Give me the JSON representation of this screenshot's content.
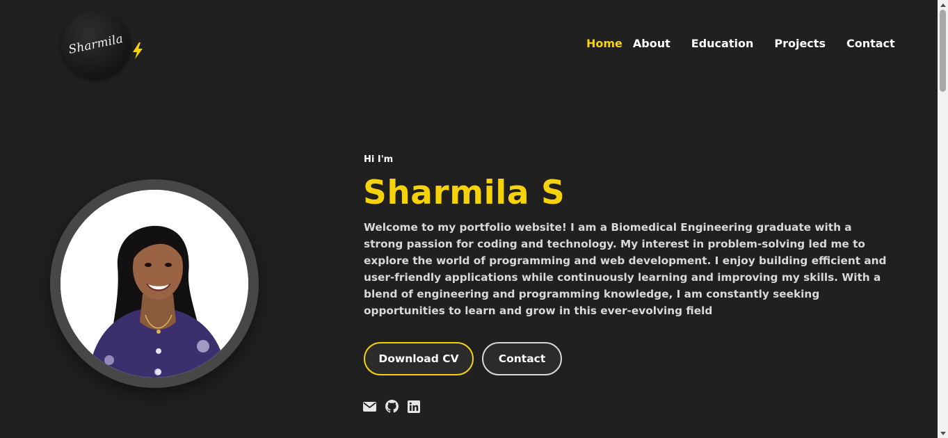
{
  "header": {
    "logo_text": "Sharmila",
    "logo_accent_icon": "lightning-bolt-icon"
  },
  "nav": {
    "items": [
      {
        "label": "Home",
        "active": true
      },
      {
        "label": "About",
        "active": false
      },
      {
        "label": "Education",
        "active": false
      },
      {
        "label": "Projects",
        "active": false
      },
      {
        "label": "Contact",
        "active": false
      }
    ]
  },
  "hero": {
    "greeting": "Hi I'm",
    "name": "Sharmila S",
    "bio": "Welcome to my portfolio website! I am a Biomedical Engineering graduate with a strong passion for coding and technology. My interest in problem-solving led me to explore the world of programming and web development. I enjoy building efficient and user-friendly applications while continuously learning and improving my skills. With a blend of engineering and programming knowledge, I am constantly seeking opportunities to learn and grow in this ever-evolving field",
    "buttons": {
      "download_cv": "Download CV",
      "contact": "Contact"
    },
    "socials": [
      "email-icon",
      "github-icon",
      "linkedin-icon"
    ]
  },
  "theme": {
    "background": "#202020",
    "accent": "#f6d20a",
    "text": "#ffffff",
    "muted_text": "#d9d9d9"
  }
}
